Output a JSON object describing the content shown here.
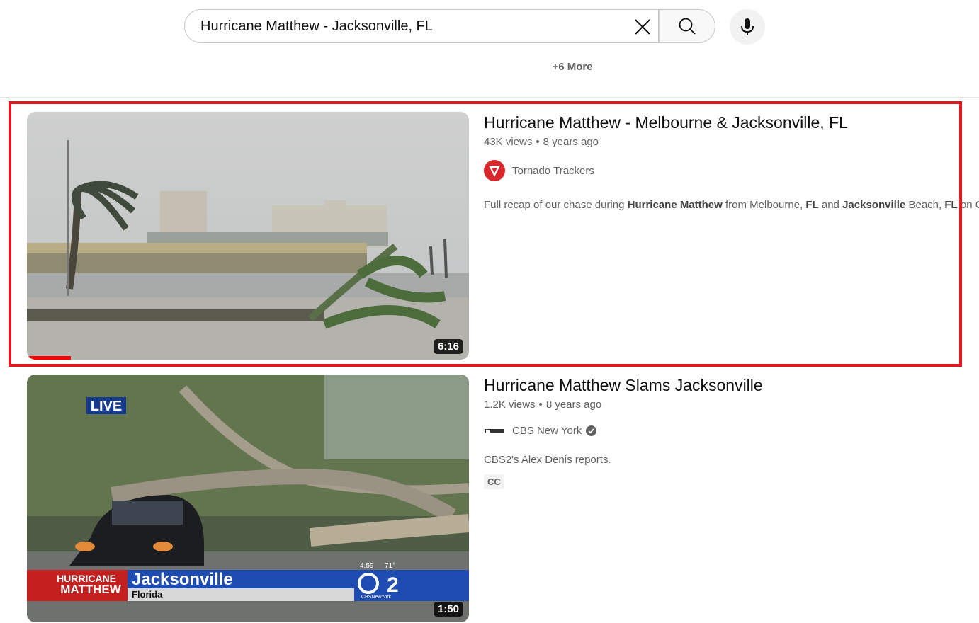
{
  "search": {
    "query": "Hurricane Matthew - Jacksonville, FL",
    "more_label": "+6 More"
  },
  "results": [
    {
      "title": "Hurricane Matthew - Melbourne & Jacksonville, FL",
      "views": "43K views",
      "age": "8 years ago",
      "channel": "Tornado Trackers",
      "description": {
        "p1": "Full recap of our chase during ",
        "b1": "Hurricane Matthew",
        "p2": " from Melbourne, ",
        "b2": "FL",
        "p3": " and ",
        "b3": "Jacksonville",
        "p4": " Beach, ",
        "b4": "FL",
        "p5": " on Octo"
      },
      "duration": "6:16",
      "watched_fraction": 0.1
    },
    {
      "title": "Hurricane Matthew Slams Jacksonville",
      "views": "1.2K views",
      "age": "8 years ago",
      "channel": "CBS New York",
      "verified": true,
      "description": "CBS2's Alex Denis reports.",
      "badge": "CC",
      "duration": "1:50",
      "overlay": {
        "live": "LIVE",
        "banner_top": "HURRICANE",
        "banner_bottom": "MATTHEW",
        "city": "Jacksonville",
        "state": "Florida",
        "time": "4:59",
        "temp": "71°",
        "logo_num": "2",
        "logo_sub": "CBSNewYork"
      }
    }
  ],
  "colors": {
    "highlight": "#e3191f",
    "progress": "#ff0000"
  }
}
